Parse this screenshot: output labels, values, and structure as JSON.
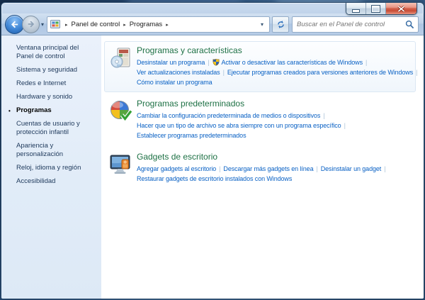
{
  "window": {
    "caption_buttons": [
      {
        "name": "minimize"
      },
      {
        "name": "maximize"
      },
      {
        "name": "close"
      }
    ]
  },
  "navbar": {
    "breadcrumb": [
      "Panel de control",
      "Programas"
    ],
    "arrow_glyph": "▸",
    "dropdown_glyph": "▾",
    "search_placeholder": "Buscar en el Panel de control"
  },
  "sidebar": {
    "bullet_glyph": "•",
    "items": [
      {
        "label": "Ventana principal del Panel de control",
        "current": false
      },
      {
        "label": "Sistema y seguridad",
        "current": false
      },
      {
        "label": "Redes e Internet",
        "current": false
      },
      {
        "label": "Hardware y sonido",
        "current": false
      },
      {
        "label": "Programas",
        "current": true
      },
      {
        "label": "Cuentas de usuario y protección infantil",
        "current": false
      },
      {
        "label": "Apariencia y personalización",
        "current": false
      },
      {
        "label": "Reloj, idioma y región",
        "current": false
      },
      {
        "label": "Accesibilidad",
        "current": false
      }
    ]
  },
  "main": {
    "link_separator": "|",
    "sections": [
      {
        "id": "programs-features",
        "icon": "programs-features-icon",
        "title": "Programas y características",
        "highlighted": true,
        "rows": [
          {
            "links": [
              {
                "label": "Desinstalar un programa"
              },
              {
                "label": "Activar o desactivar las características de Windows",
                "shield": true
              }
            ],
            "trailing_sep": true
          },
          {
            "links": [
              {
                "label": "Ver actualizaciones instaladas"
              },
              {
                "label": "Ejecutar programas creados para versiones anteriores de Windows"
              }
            ],
            "trailing_sep": true
          },
          {
            "links": [
              {
                "label": "Cómo instalar un programa"
              }
            ],
            "trailing_sep": false
          }
        ]
      },
      {
        "id": "default-programs",
        "icon": "default-programs-icon",
        "title": "Programas predeterminados",
        "highlighted": false,
        "rows": [
          {
            "links": [
              {
                "label": "Cambiar la configuración predeterminada de medios o dispositivos"
              }
            ],
            "trailing_sep": true
          },
          {
            "links": [
              {
                "label": "Hacer que un tipo de archivo se abra siempre con un programa específico"
              }
            ],
            "trailing_sep": true
          },
          {
            "links": [
              {
                "label": "Establecer programas predeterminados"
              }
            ],
            "trailing_sep": false
          }
        ]
      },
      {
        "id": "desktop-gadgets",
        "icon": "desktop-gadgets-icon",
        "title": "Gadgets de escritorio",
        "highlighted": false,
        "rows": [
          {
            "links": [
              {
                "label": "Agregar gadgets al escritorio"
              },
              {
                "label": "Descargar más gadgets en línea"
              },
              {
                "label": "Desinstalar un gadget"
              }
            ],
            "trailing_sep": true
          },
          {
            "links": [
              {
                "label": "Restaurar gadgets de escritorio instalados con Windows"
              }
            ],
            "trailing_sep": false
          }
        ]
      }
    ]
  }
}
